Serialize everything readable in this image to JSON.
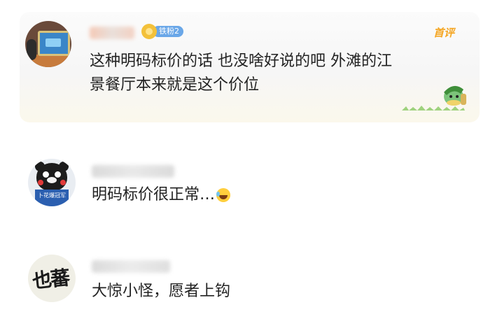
{
  "comments": [
    {
      "is_hot": true,
      "hot_label": "首评",
      "fan_badge": "铁粉2",
      "text_line1": "这种明码标价的话 也没啥好说的吧 外滩的江",
      "text_line2": "景餐厅本来就是这个价位"
    },
    {
      "text": "明码标价很正常…",
      "emoji": "laugh-cry-emoji",
      "avatar_caption": "卜花爆冠军"
    },
    {
      "text": "大惊小怪，愿者上钩",
      "avatar_callig": "也蕃"
    }
  ],
  "colors": {
    "hot_label": "#f5a623",
    "fan_badge_bg": "#6aa7e8",
    "text": "#222222"
  }
}
